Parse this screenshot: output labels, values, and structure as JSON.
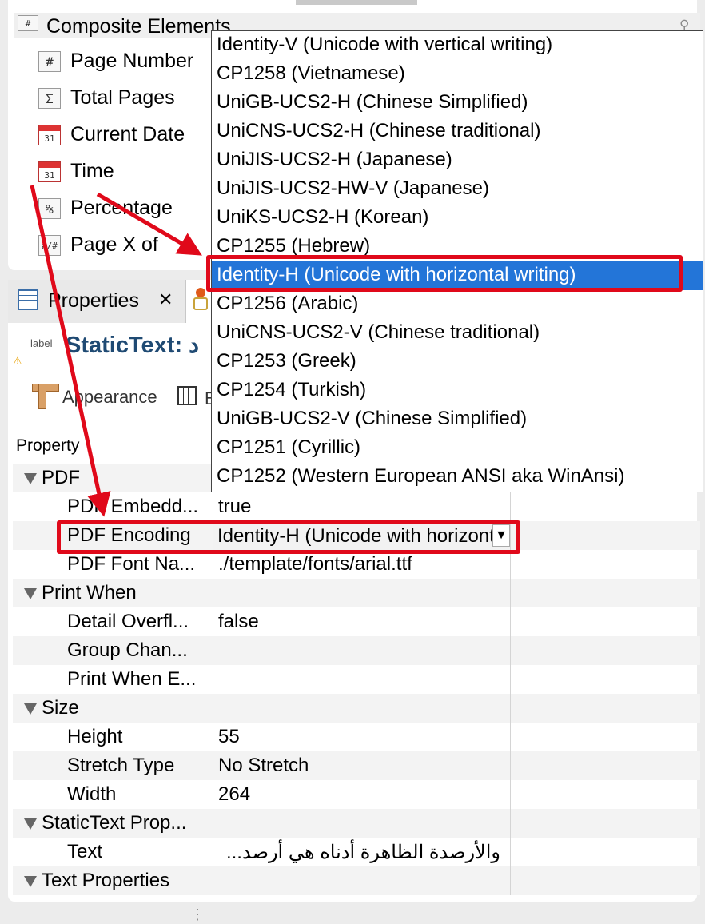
{
  "palette": {
    "group_title": "Composite Elements",
    "items": [
      {
        "label": "Page Number",
        "icon": "hash-icon",
        "glyph": "#"
      },
      {
        "label": "Total Pages",
        "icon": "sigma-icon",
        "glyph": "Σ"
      },
      {
        "label": "Current Date",
        "icon": "calendar-icon",
        "glyph": "31"
      },
      {
        "label": "Time",
        "icon": "calendar-icon",
        "glyph": "31"
      },
      {
        "label": "Percentage",
        "icon": "percent-icon",
        "glyph": "%"
      },
      {
        "label": "Page X of",
        "icon": "hash-hash-icon",
        "glyph": "#/#"
      }
    ]
  },
  "properties_view": {
    "tab_title": "Properties",
    "element_label_icon": "label",
    "element_title": "StaticText: د",
    "tabs": {
      "appearance": "Appearance",
      "borders": "B"
    },
    "column_header": "Property"
  },
  "rows": [
    {
      "type": "group",
      "key": "PDF"
    },
    {
      "type": "prop",
      "key": "PDF Embedd...",
      "value": "true"
    },
    {
      "type": "prop",
      "key": "PDF Encoding",
      "value": "Identity-H (Unicode with horizontal writing)"
    },
    {
      "type": "prop",
      "key": "PDF Font Na...",
      "value": "./template/fonts/arial.ttf"
    },
    {
      "type": "group",
      "key": "Print When"
    },
    {
      "type": "prop",
      "key": "Detail Overfl...",
      "value": "false"
    },
    {
      "type": "prop",
      "key": "Group Chan...",
      "value": ""
    },
    {
      "type": "prop",
      "key": "Print When E...",
      "value": ""
    },
    {
      "type": "group",
      "key": "Size"
    },
    {
      "type": "prop",
      "key": "Height",
      "value": "55"
    },
    {
      "type": "prop",
      "key": "Stretch Type",
      "value": "No Stretch"
    },
    {
      "type": "prop",
      "key": "Width",
      "value": "264"
    },
    {
      "type": "group",
      "key": "StaticText Prop..."
    },
    {
      "type": "prop",
      "key": "Text",
      "value": "والأرصدة الظاهرة أدناه هي أرصد..."
    },
    {
      "type": "group",
      "key": "Text Properties"
    }
  ],
  "encoding_combo": {
    "selected": "Identity-H (Unicode with horizontal writing)",
    "arrow": "▼"
  },
  "dropdown_options": [
    "Identity-V (Unicode with vertical writing)",
    "CP1258 (Vietnamese)",
    "UniGB-UCS2-H (Chinese Simplified)",
    "UniCNS-UCS2-H (Chinese traditional)",
    "UniJIS-UCS2-H (Japanese)",
    "UniJIS-UCS2-HW-V (Japanese)",
    "UniKS-UCS2-H (Korean)",
    "CP1255 (Hebrew)",
    "Identity-H (Unicode with horizontal writing)",
    "CP1256 (Arabic)",
    "UniCNS-UCS2-V (Chinese traditional)",
    "CP1253 (Greek)",
    "CP1254 (Turkish)",
    "UniGB-UCS2-V (Chinese Simplified)",
    "CP1251 (Cyrillic)",
    "CP1252 (Western European ANSI aka WinAnsi)"
  ],
  "dropdown_selected_index": 8,
  "colors": {
    "highlight": "#2375d8",
    "annotation": "#e0091a",
    "title": "#1f4a73"
  }
}
